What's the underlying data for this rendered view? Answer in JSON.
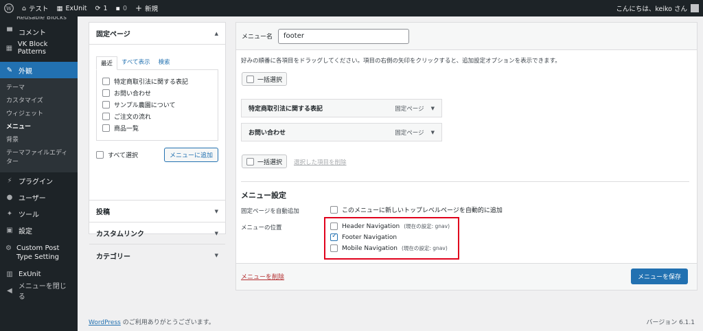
{
  "adminbar": {
    "site": "テスト",
    "exunit": "ExUnit",
    "updates": "1",
    "comments": "0",
    "new": "新規",
    "greeting": "こんにちは、keiko さん"
  },
  "sidebar": {
    "top_cut": "Reusable Blocks",
    "items": [
      {
        "label": "コメント",
        "icon": "comment-icon"
      },
      {
        "label": "VK Block Patterns",
        "icon": "grid-icon"
      },
      {
        "label": "外観",
        "icon": "paintbrush-icon"
      }
    ],
    "submenu": [
      "テーマ",
      "カスタマイズ",
      "ウィジェット",
      "メニュー",
      "背景",
      "テーマファイルエディター"
    ],
    "items2": [
      {
        "label": "プラグイン",
        "icon": "plugin-icon"
      },
      {
        "label": "ユーザー",
        "icon": "user-icon"
      },
      {
        "label": "ツール",
        "icon": "wrench-icon"
      },
      {
        "label": "設定",
        "icon": "settings-icon"
      },
      {
        "label": "Custom Post Type Setting",
        "icon": "gear-icon"
      },
      {
        "label": "ExUnit",
        "icon": "chart-icon"
      },
      {
        "label": "メニューを閉じる",
        "icon": "collapse-icon"
      }
    ]
  },
  "left": {
    "pages_title": "固定ページ",
    "tabs": [
      "最近",
      "すべて表示",
      "検索"
    ],
    "pages": [
      "特定商取引法に関する表記",
      "お問い合わせ",
      "サンプル農園について",
      "ご注文の流れ",
      "商品一覧"
    ],
    "select_all": "すべて選択",
    "add_button": "メニューに追加",
    "sections": [
      "投稿",
      "カスタムリンク",
      "カテゴリー"
    ]
  },
  "right": {
    "menu_name_label": "メニュー名",
    "menu_name_value": "footer",
    "instructions": "好みの順番に各項目をドラッグしてください。項目の右側の矢印をクリックすると、追加設定オプションを表示できます。",
    "bulk_select": "一括選択",
    "items": [
      {
        "title": "特定商取引法に関する表記",
        "type": "固定ページ"
      },
      {
        "title": "お問い合わせ",
        "type": "固定ページ"
      }
    ],
    "remove_selected": "選択した項目を削除",
    "settings_title": "メニュー設定",
    "auto_add_label": "固定ページを自動追加",
    "auto_add_text": "このメニューに新しいトップレベルページを自動的に追加",
    "location_label": "メニューの位置",
    "locations": [
      {
        "name": "Header Navigation",
        "note": "(現在の設定: gnav)",
        "checked": false
      },
      {
        "name": "Footer Navigation",
        "note": "",
        "checked": true
      },
      {
        "name": "Mobile Navigation",
        "note": "(現在の設定: gnav)",
        "checked": false
      }
    ],
    "delete_menu": "メニューを削除",
    "save_button": "メニューを保存"
  },
  "footer": {
    "wp_link": "WordPress",
    "thanks": " のご利用ありがとうございます。",
    "version": "バージョン 6.1.1"
  },
  "colors": {
    "accent": "#2271b1",
    "highlight": "#e0001b"
  }
}
